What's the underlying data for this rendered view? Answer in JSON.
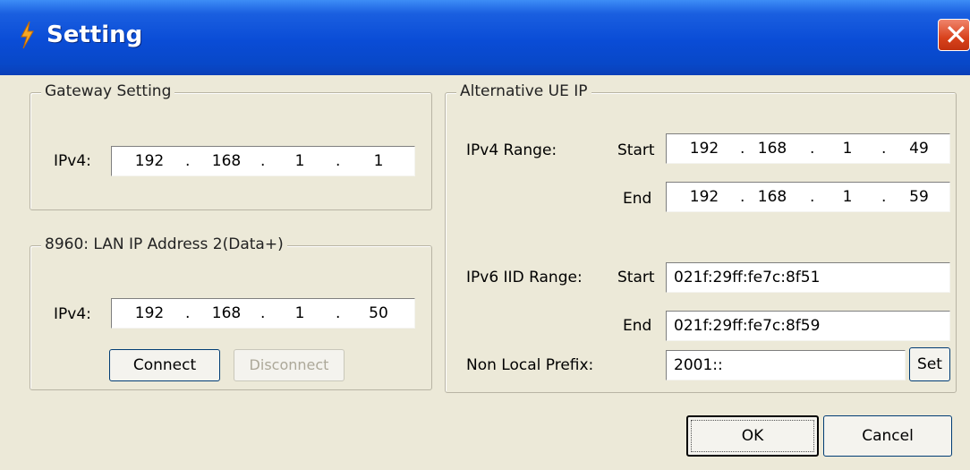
{
  "window": {
    "title": "Setting",
    "close_glyph": "✕"
  },
  "gateway": {
    "legend": "Gateway Setting",
    "ipv4_label": "IPv4:",
    "octets": [
      "192",
      "168",
      "1",
      "1"
    ]
  },
  "lan": {
    "legend": "8960: LAN IP Address 2(Data+)",
    "ipv4_label": "IPv4:",
    "octets": [
      "192",
      "168",
      "1",
      "50"
    ],
    "connect_label": "Connect",
    "disconnect_label": "Disconnect"
  },
  "alt": {
    "legend": "Alternative UE IP",
    "ipv4_range_label": "IPv4 Range:",
    "start_label": "Start",
    "end_label": "End",
    "ipv4_start": [
      "192",
      "168",
      "1",
      "49"
    ],
    "ipv4_end": [
      "192",
      "168",
      "1",
      "59"
    ],
    "ipv6_range_label": "IPv6 IID Range:",
    "ipv6_start": "021f:29ff:fe7c:8f51",
    "ipv6_end": "021f:29ff:fe7c:8f59",
    "prefix_label": "Non Local Prefix:",
    "prefix_value": "2001::",
    "set_label": "Set"
  },
  "footer": {
    "ok_label": "OK",
    "cancel_label": "Cancel"
  },
  "dot": "."
}
